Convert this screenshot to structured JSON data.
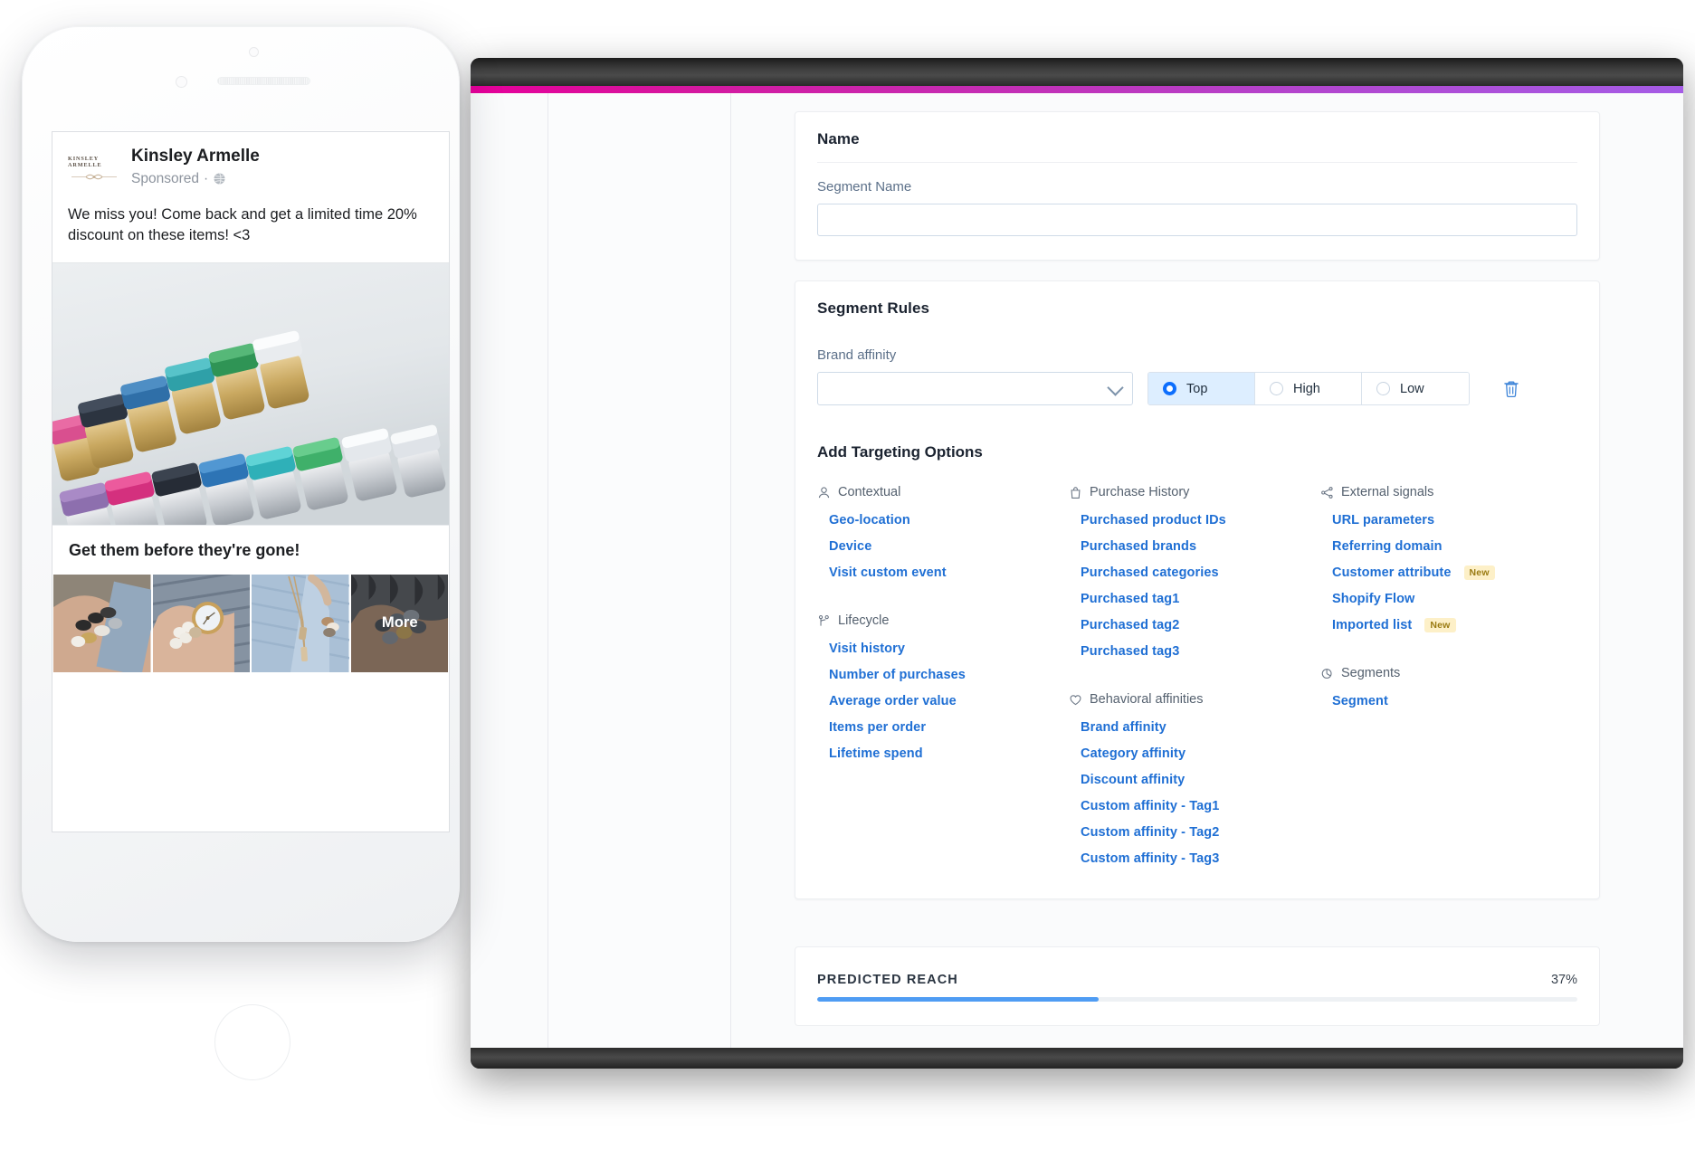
{
  "browser": {
    "accent_start_color": "#e6009a",
    "accent_end_color": "#a55ce6"
  },
  "form": {
    "name_card": {
      "title": "Name",
      "segment_name_label": "Segment Name",
      "segment_name_value": "",
      "segment_name_placeholder": ""
    },
    "rules_card": {
      "title": "Segment Rules",
      "rule_label": "Brand affinity",
      "rule_select_value": "",
      "levels": [
        {
          "label": "Top",
          "selected": true
        },
        {
          "label": "High",
          "selected": false
        },
        {
          "label": "Low",
          "selected": false
        }
      ],
      "delete_icon": "trash-icon"
    },
    "targeting": {
      "title": "Add Targeting Options",
      "columns": [
        {
          "groups": [
            {
              "heading": "Contextual",
              "icon": "person-icon",
              "items": [
                {
                  "label": "Geo-location"
                },
                {
                  "label": "Device"
                },
                {
                  "label": "Visit custom event"
                }
              ]
            },
            {
              "heading": "Lifecycle",
              "icon": "branch-icon",
              "items": [
                {
                  "label": "Visit history"
                },
                {
                  "label": "Number of purchases"
                },
                {
                  "label": "Average order value"
                },
                {
                  "label": "Items per order"
                },
                {
                  "label": "Lifetime spend"
                }
              ]
            }
          ]
        },
        {
          "groups": [
            {
              "heading": "Purchase History",
              "icon": "bag-icon",
              "items": [
                {
                  "label": "Purchased product IDs"
                },
                {
                  "label": "Purchased brands"
                },
                {
                  "label": "Purchased categories"
                },
                {
                  "label": "Purchased tag1"
                },
                {
                  "label": "Purchased tag2"
                },
                {
                  "label": "Purchased tag3"
                }
              ]
            },
            {
              "heading": "Behavioral affinities",
              "icon": "heart-icon",
              "items": [
                {
                  "label": "Brand affinity"
                },
                {
                  "label": "Category affinity"
                },
                {
                  "label": "Discount affinity"
                },
                {
                  "label": "Custom affinity - Tag1"
                },
                {
                  "label": "Custom affinity - Tag2"
                },
                {
                  "label": "Custom affinity - Tag3"
                }
              ]
            }
          ]
        },
        {
          "groups": [
            {
              "heading": "External signals",
              "icon": "share-icon",
              "items": [
                {
                  "label": "URL parameters"
                },
                {
                  "label": "Referring domain"
                },
                {
                  "label": "Customer attribute",
                  "badge": "New"
                },
                {
                  "label": "Shopify Flow"
                },
                {
                  "label": "Imported list",
                  "badge": "New"
                }
              ]
            },
            {
              "heading": "Segments",
              "icon": "pie-icon",
              "items": [
                {
                  "label": "Segment"
                }
              ]
            }
          ]
        }
      ]
    },
    "predicted_reach": {
      "label": "PREDICTED REACH",
      "value": "37%",
      "percent": 37,
      "fill_color": "#4f9cf3"
    }
  },
  "phone_ad": {
    "brand_logo_line1": "KINSLEY ARMELLE",
    "advertiser": "Kinsley Armelle",
    "sponsored_label": "Sponsored",
    "sponsored_separator": "·",
    "globe_icon": "globe-icon",
    "body_text": "We miss you! Come back and get a limited time 20% discount on these items! <3",
    "headline": "Get them before they're gone!",
    "more_label": "More",
    "thumbnails": [
      {
        "alt": "stacked-bracelets-on-wrist"
      },
      {
        "alt": "gold-watch-with-beaded-bracelets"
      },
      {
        "alt": "layered-necklace-blue-sweater"
      },
      {
        "alt": "grey-bead-bracelets"
      }
    ]
  }
}
